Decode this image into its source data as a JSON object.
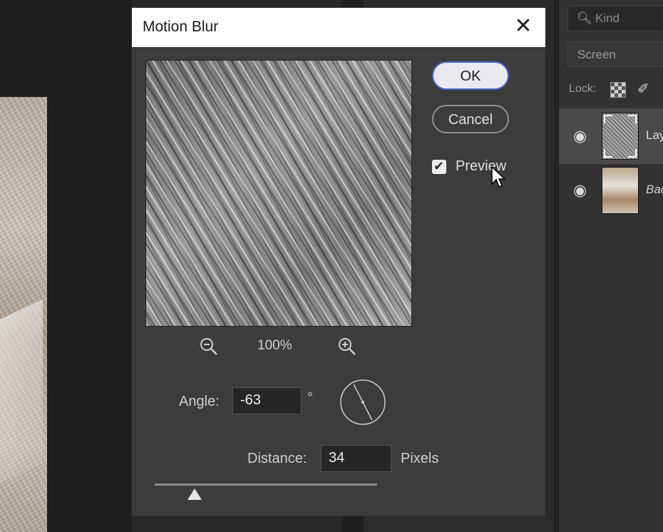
{
  "dialog": {
    "title": "Motion Blur",
    "ok_label": "OK",
    "cancel_label": "Cancel",
    "preview_label": "Preview",
    "preview_checked": true,
    "zoom_level": "100%",
    "angle_label": "Angle:",
    "angle_value": "-63",
    "degree_symbol": "°",
    "distance_label": "Distance:",
    "distance_value": "34",
    "distance_unit": "Pixels",
    "distance_slider_fraction": 0.18
  },
  "layers_panel": {
    "filter_placeholder": "Kind",
    "blend_mode": "Screen",
    "lock_label": "Lock:",
    "layers": [
      {
        "name": "Lay",
        "selected": true,
        "visible": true,
        "thumbnail": "noise-smart-object"
      },
      {
        "name": "Bac",
        "selected": false,
        "visible": true,
        "thumbnail": "photo"
      }
    ]
  },
  "colors": {
    "accent": "#4b64c8",
    "dialog_bg": "#3c3c3c",
    "titlebar_bg": "#ffffff"
  },
  "icons": {
    "close": "close-icon",
    "zoom_out": "zoom-out-icon",
    "zoom_in": "zoom-in-icon",
    "eye": "eye-icon",
    "search": "search-icon"
  }
}
